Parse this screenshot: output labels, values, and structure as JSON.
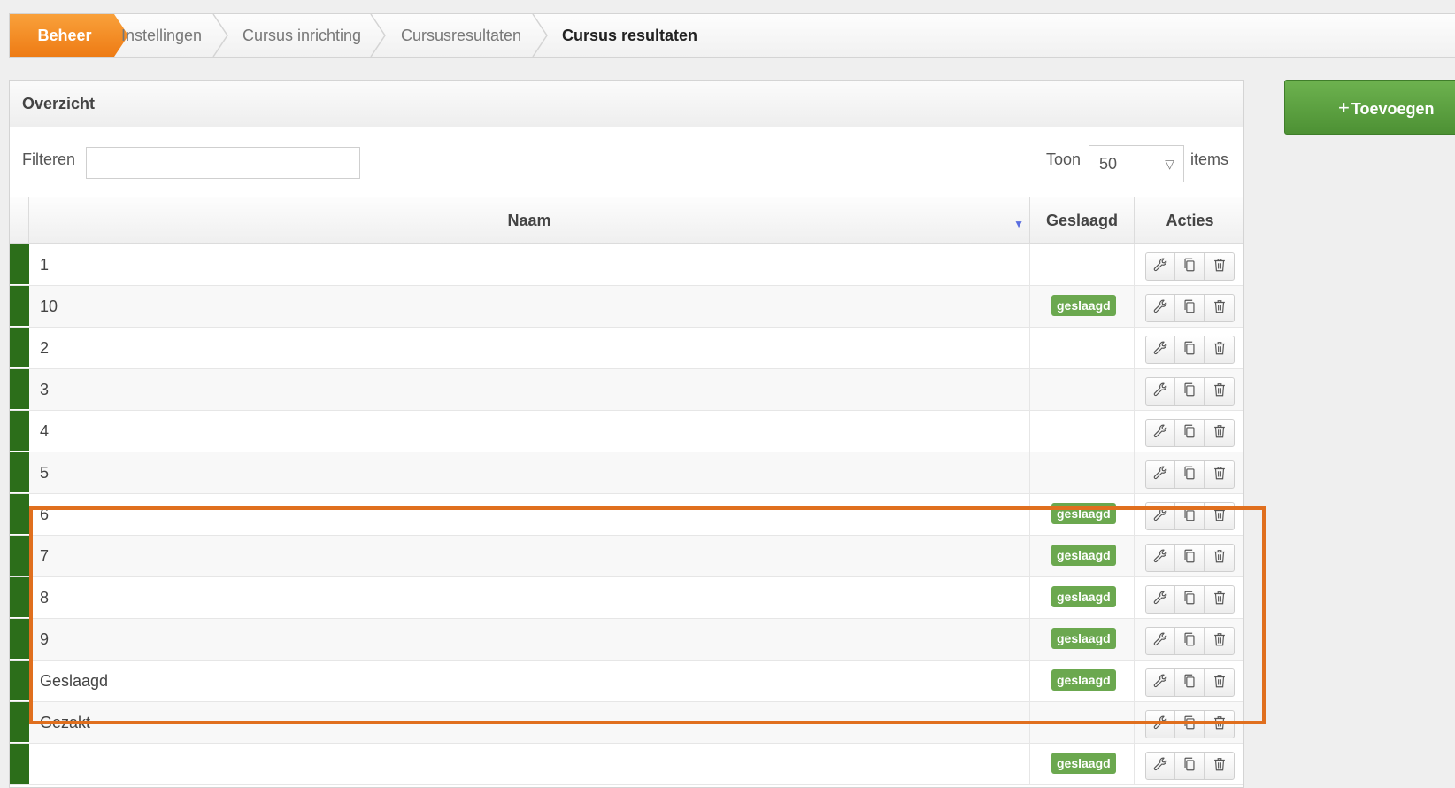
{
  "breadcrumb": {
    "items": [
      "Beheer",
      "Instellingen",
      "Cursus inrichting",
      "Cursusresultaten",
      "Cursus resultaten"
    ]
  },
  "panel": {
    "title": "Overzicht",
    "filter_label": "Filteren",
    "filter_value": "",
    "toon_label": "Toon",
    "toon_value": "50",
    "items_label": "items"
  },
  "table": {
    "headers": {
      "naam": "Naam",
      "geslaagd": "Geslaagd",
      "acties": "Acties"
    },
    "rows": [
      {
        "naam": "1",
        "badge": ""
      },
      {
        "naam": "10",
        "badge": "geslaagd"
      },
      {
        "naam": "2",
        "badge": ""
      },
      {
        "naam": "3",
        "badge": ""
      },
      {
        "naam": "4",
        "badge": ""
      },
      {
        "naam": "5",
        "badge": ""
      },
      {
        "naam": "6",
        "badge": "geslaagd"
      },
      {
        "naam": "7",
        "badge": "geslaagd"
      },
      {
        "naam": "8",
        "badge": "geslaagd"
      },
      {
        "naam": "9",
        "badge": "geslaagd"
      },
      {
        "naam": "Geslaagd",
        "badge": "geslaagd"
      },
      {
        "naam": "Gezakt",
        "badge": ""
      },
      {
        "naam": "",
        "badge": "geslaagd"
      }
    ]
  },
  "add_button": {
    "plus": "+",
    "label": "Toevoegen"
  },
  "colors": {
    "accent_orange": "#ee7b14",
    "stripe_green": "#2c6e1a",
    "badge_green": "#6ba84f",
    "highlight": "#e06f1e"
  }
}
